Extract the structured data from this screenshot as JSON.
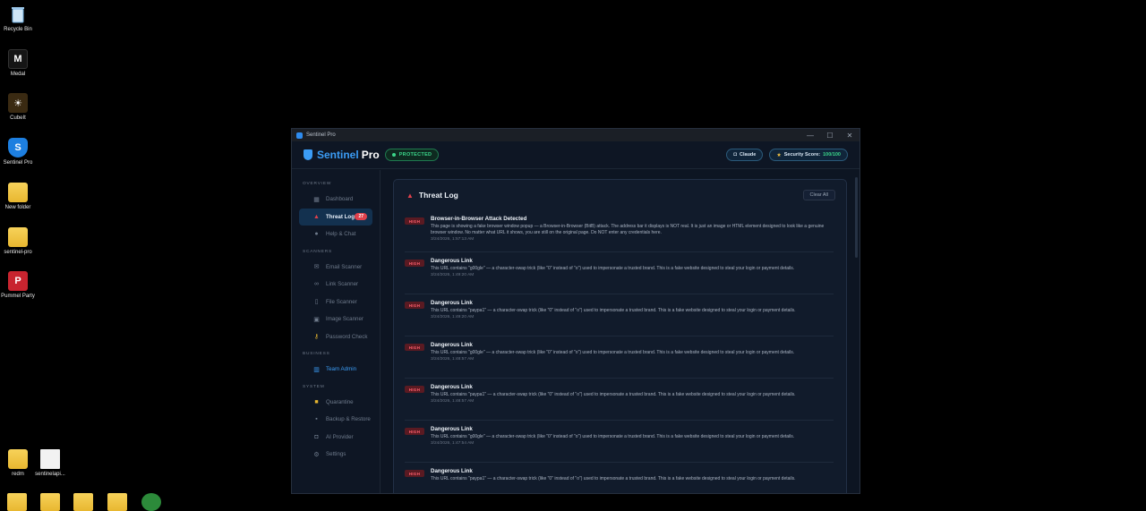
{
  "desktop": {
    "icons": [
      {
        "label": "Recycle Bin"
      },
      {
        "label": "Medal"
      },
      {
        "label": "CubeIt"
      },
      {
        "label": "Sentinel Pro"
      },
      {
        "label": "New folder"
      },
      {
        "label": "sentinel-pro"
      },
      {
        "label": "Pummel Party"
      },
      {
        "label": "redm"
      },
      {
        "label": "sentinelapi..."
      }
    ]
  },
  "window": {
    "title": "Sentinel Pro",
    "controls": {
      "minimize": "—",
      "maximize": "☐",
      "close": "✕"
    }
  },
  "header": {
    "brand_accent": "Sentinel",
    "brand_rest": "Pro",
    "status_badge": "PROTECTED",
    "ai_pill": "Claude",
    "score_label": "Security Score:",
    "score_value": "100/100"
  },
  "sidebar": {
    "overview_label": "OVERVIEW",
    "dashboard": "Dashboard",
    "threat_log": "Threat Log",
    "threat_count": "27",
    "help_chat": "Help & Chat",
    "scanners_label": "SCANNERS",
    "email_scanner": "Email Scanner",
    "link_scanner": "Link Scanner",
    "file_scanner": "File Scanner",
    "image_scanner": "Image Scanner",
    "password_check": "Password Check",
    "business_label": "BUSINESS",
    "team_admin": "Team Admin",
    "system_label": "SYSTEM",
    "quarantine": "Quarantine",
    "backup_restore": "Backup & Restore",
    "ai_provider": "AI Provider",
    "settings": "Settings"
  },
  "threat_log": {
    "title": "Threat Log",
    "clear_all": "Clear All",
    "entries": [
      {
        "severity": "HIGH",
        "title": "Browser-in-Browser Attack Detected",
        "text": "This page is showing a fake browser window popup — a Browser-in-Browser (BitB) attack. The address bar it displays is NOT real. It is just an image or HTML element designed to look like a genuine browser window. No matter what URL it shows, you are still on the original page. Do NOT enter any credentials here.",
        "time": "3/24/2026, 1:57:13 AM"
      },
      {
        "severity": "HIGH",
        "title": "Dangerous Link",
        "text": "This URL contains \"g00gle\" — a character-swap trick (like \"0\" instead of \"o\") used to impersonate a trusted brand. This is a fake website designed to steal your login or payment details.",
        "time": "3/24/2026, 1:49:20 AM"
      },
      {
        "severity": "HIGH",
        "title": "Dangerous Link",
        "text": "This URL contains \"paypa1\" — a character-swap trick (like \"0\" instead of \"o\") used to impersonate a trusted brand. This is a fake website designed to steal your login or payment details.",
        "time": "3/24/2026, 1:49:20 AM"
      },
      {
        "severity": "HIGH",
        "title": "Dangerous Link",
        "text": "This URL contains \"g00gle\" — a character-swap trick (like \"0\" instead of \"o\") used to impersonate a trusted brand. This is a fake website designed to steal your login or payment details.",
        "time": "3/24/2026, 1:48:57 AM"
      },
      {
        "severity": "HIGH",
        "title": "Dangerous Link",
        "text": "This URL contains \"paypa1\" — a character-swap trick (like \"0\" instead of \"o\") used to impersonate a trusted brand. This is a fake website designed to steal your login or payment details.",
        "time": "3/24/2026, 1:48:57 AM"
      },
      {
        "severity": "HIGH",
        "title": "Dangerous Link",
        "text": "This URL contains \"g00gle\" — a character-swap trick (like \"0\" instead of \"o\") used to impersonate a trusted brand. This is a fake website designed to steal your login or payment details.",
        "time": "3/24/2026, 1:47:54 AM"
      },
      {
        "severity": "HIGH",
        "title": "Dangerous Link",
        "text": "This URL contains \"paypa1\" — a character-swap trick (like \"0\" instead of \"o\") used to impersonate a trusted brand. This is a fake website designed to steal your login or payment details.",
        "time": ""
      }
    ]
  }
}
